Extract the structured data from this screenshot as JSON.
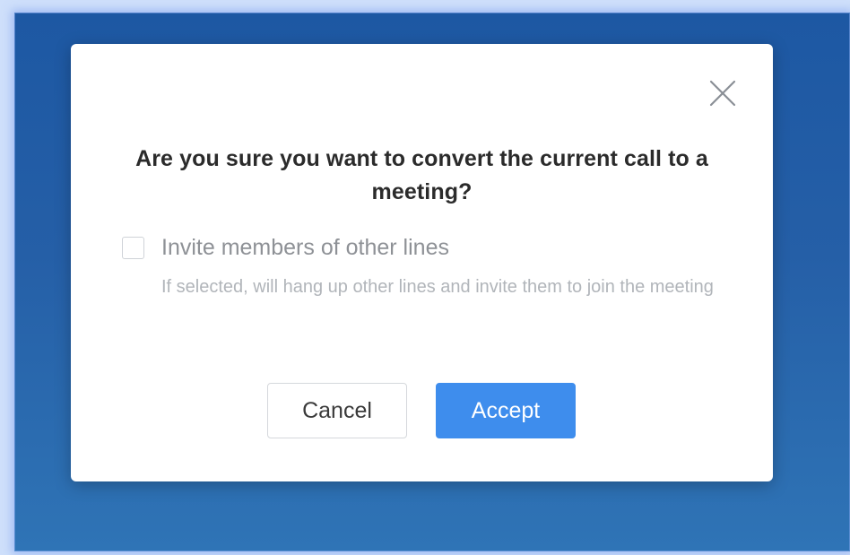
{
  "dialog": {
    "title": "Are you sure you want to convert the current call to a meeting?",
    "close_icon": "close-icon",
    "option": {
      "label": "Invite members of other lines",
      "hint": "If selected, will hang up other lines and invite them to join the meeting",
      "checked": false
    },
    "cancel_label": "Cancel",
    "accept_label": "Accept"
  },
  "colors": {
    "accent": "#3e8ded",
    "backdrop": "#1d58a3"
  }
}
